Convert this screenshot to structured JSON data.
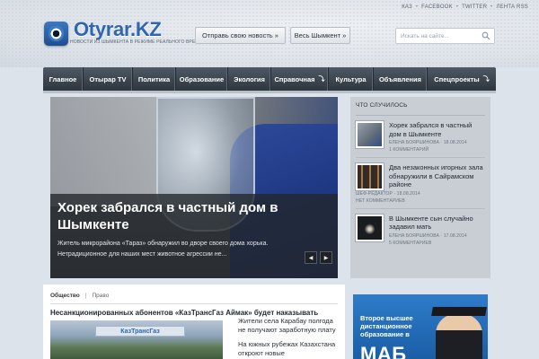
{
  "header": {
    "top_links": [
      "КАЗ",
      "FACEBOOK",
      "TWITTER",
      "ЛЕНТА RSS"
    ],
    "logo_text": "Otyrar.KZ",
    "tagline": "НОВОСТИ ИЗ ШЫМКЕНТА В РЕЖИМЕ РЕАЛЬНОГО ВРЕМЕНИ",
    "send_news_label": "Отправь свою новость »",
    "all_shymkent_label": "Весь Шымкент »",
    "search_placeholder": "Искать на сайте..."
  },
  "nav": {
    "items": [
      {
        "label": "Главное",
        "arrow": ""
      },
      {
        "label": "Отырар TV",
        "arrow": ""
      },
      {
        "label": "Политика",
        "arrow": ""
      },
      {
        "label": "Образование",
        "arrow": ""
      },
      {
        "label": "Экология",
        "arrow": ""
      },
      {
        "label": "Справочная",
        "arrow": "⤵"
      },
      {
        "label": "Культура",
        "arrow": ""
      },
      {
        "label": "Объявления",
        "arrow": ""
      },
      {
        "label": "Спецпроекты",
        "arrow": "⤵"
      }
    ]
  },
  "slider": {
    "title": "Хорек забрался в частный дом в Шымкенте",
    "text": "Житель микрорайона «Тараз» обнаружил во дворе своего дома хорька. Нетрадиционное для наших мест животное агрессии не...",
    "prev": "◀",
    "next": "▶"
  },
  "side": {
    "heading": "ЧТО СЛУЧИЛОСЬ",
    "items": [
      {
        "title": "Хорек забрался в частный дом в Шымкенте",
        "meta": "ЕЛЕНА БОЯРШИНОВА · 18.08.2014",
        "comments": "1 КОММЕНТАРИЙ"
      },
      {
        "title": "Два незаконных игорных зала обнаружили в Сайрамском районе",
        "meta": "ШЕФ-РЕДАКТОР · 18.08.2014",
        "comments": "НЕТ КОММЕНТАРИЕВ"
      },
      {
        "title": "В Шымкенте сын случайно задавил мать",
        "meta": "ЕЛЕНА БОЯРШИНОВА · 17.08.2014",
        "comments": "5 КОММЕНТАРИЕВ"
      }
    ]
  },
  "content": {
    "tab_active": "Общество",
    "tab_separator": "|",
    "tab_other": "Право",
    "headline": "Несанкционированных абонентов «КазТрансГаз Аймак» будет наказывать",
    "image_sign": "КазТрансГаз",
    "links": [
      "Жители села Карабау полгода не получают заработную плату",
      "На южных рубежах Казахстана откроют новые"
    ]
  },
  "ad": {
    "text": "Второе высшее дистанционное образование в",
    "logo": "МАБ"
  }
}
